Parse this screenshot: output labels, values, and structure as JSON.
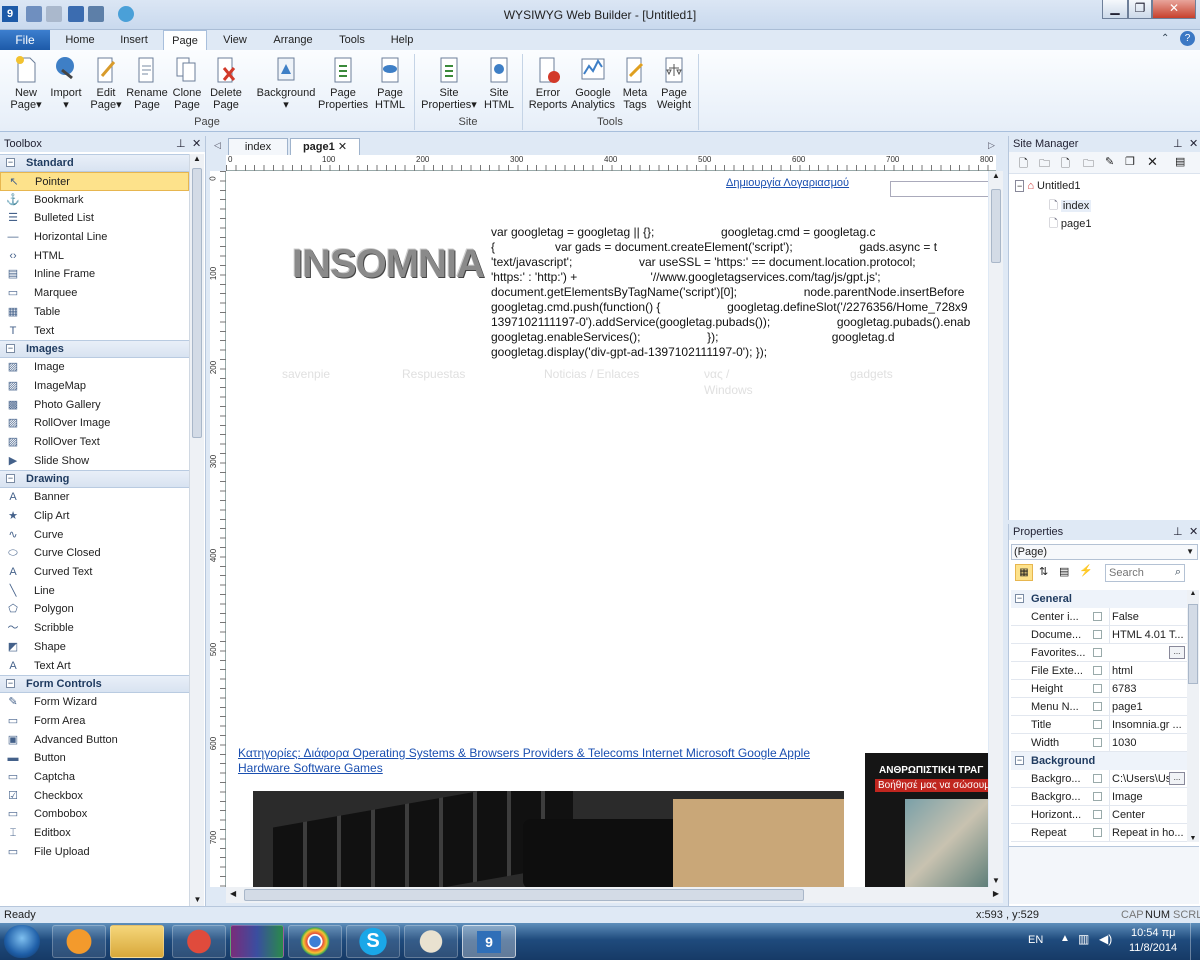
{
  "window": {
    "title": "WYSIWYG Web Builder - [Untitled1]",
    "app_badge": "9"
  },
  "ribbon_tabs": {
    "file": "File",
    "home": "Home",
    "insert": "Insert",
    "page": "Page",
    "view": "View",
    "arrange": "Arrange",
    "tools": "Tools",
    "help": "Help"
  },
  "ribbon": {
    "new_page_1": "New",
    "new_page_2": "Page",
    "import": "Import",
    "edit_page_1": "Edit",
    "edit_page_2": "Page",
    "rename_page_1": "Rename",
    "rename_page_2": "Page",
    "clone_page_1": "Clone",
    "clone_page_2": "Page",
    "delete_page_1": "Delete",
    "delete_page_2": "Page",
    "background": "Background",
    "page_properties_1": "Page",
    "page_properties_2": "Properties",
    "page_html_1": "Page",
    "page_html_2": "HTML",
    "site_properties_1": "Site",
    "site_properties_2": "Properties",
    "site_html_1": "Site",
    "site_html_2": "HTML",
    "error_reports_1": "Error",
    "error_reports_2": "Reports",
    "google_analytics_1": "Google",
    "google_analytics_2": "Analytics",
    "meta_tags_1": "Meta",
    "meta_tags_2": "Tags",
    "page_weight_1": "Page",
    "page_weight_2": "Weight",
    "group_page": "Page",
    "group_site": "Site",
    "group_tools": "Tools"
  },
  "toolbox": {
    "title": "Toolbox",
    "standard": {
      "label": "Standard",
      "items": [
        "Pointer",
        "Bookmark",
        "Bulleted List",
        "Horizontal Line",
        "HTML",
        "Inline Frame",
        "Marquee",
        "Table",
        "Text"
      ]
    },
    "images": {
      "label": "Images",
      "items": [
        "Image",
        "ImageMap",
        "Photo Gallery",
        "RollOver Image",
        "RollOver Text",
        "Slide Show"
      ]
    },
    "drawing": {
      "label": "Drawing",
      "items": [
        "Banner",
        "Clip Art",
        "Curve",
        "Curve Closed",
        "Curved Text",
        "Line",
        "Polygon",
        "Scribble",
        "Shape",
        "Text Art"
      ]
    },
    "form_controls": {
      "label": "Form Controls",
      "items": [
        "Form Wizard",
        "Form Area",
        "Advanced Button",
        "Button",
        "Captcha",
        "Checkbox",
        "Combobox",
        "Editbox",
        "File Upload"
      ]
    }
  },
  "doc_tabs": {
    "index": "index",
    "page1": "page1"
  },
  "ruler": {
    "h": [
      "0",
      "100",
      "200",
      "300",
      "400",
      "500",
      "600",
      "700",
      "800"
    ],
    "v": [
      "0",
      "100",
      "200",
      "300",
      "400",
      "500",
      "600",
      "700"
    ]
  },
  "canvas": {
    "account_link": "Δημιουργία Λογαριασμού",
    "logo_text": "INSOMNIA",
    "code_lines": [
      "var googletag = googletag || {};                    googletag.cmd = googletag.c",
      "{                  var gads = document.createElement('script');                    gads.async = t",
      "'text/javascript';                    var useSSL = 'https:' == document.location.protocol;",
      "'https:' : 'http:') +                      '//www.googletagservices.com/tag/js/gpt.js';",
      "document.getElementsByTagName('script')[0];                    node.parentNode.insertBefore",
      "googletag.cmd.push(function() {                    googletag.defineSlot('/2276356/Home_728x9",
      "1397102111197-0').addService(googletag.pubads());                    googletag.pubads().enab",
      "googletag.enableServices();                    });                                  googletag.d",
      "googletag.display('div-gpt-ad-1397102111197-0'); });"
    ],
    "faint_nav": [
      "savenpie",
      "Respuestas",
      "Noticias / Enlaces",
      "νας /",
      "Windows",
      "gadgets"
    ],
    "categories_line1": "Κατηγορίες: Διάφορα Operating Systems & Browsers Providers & Telecoms Internet Microsoft Google Apple",
    "categories_line2": "Hardware Software Games",
    "banner_line1": "ΑΝΘΡΩΠΙΣΤΙΚΗ ΤΡΑΓ",
    "banner_line2": "Βοήθησέ μας να σώσουμ"
  },
  "site_manager": {
    "title": "Site Manager",
    "root": "Untitled1",
    "pages": [
      "index",
      "page1"
    ]
  },
  "properties": {
    "title": "Properties",
    "selector": "(Page)",
    "search_placeholder": "Search",
    "general_label": "General",
    "general": [
      {
        "name": "Center i...",
        "value": "False"
      },
      {
        "name": "Docume...",
        "value": "HTML 4.01 T..."
      },
      {
        "name": "Favorites...",
        "value": ""
      },
      {
        "name": "File Exte...",
        "value": "html"
      },
      {
        "name": "Height",
        "value": "6783"
      },
      {
        "name": "Menu N...",
        "value": "page1"
      },
      {
        "name": "Title",
        "value": "Insomnia.gr ..."
      },
      {
        "name": "Width",
        "value": "1030"
      }
    ],
    "background_label": "Background",
    "background": [
      {
        "name": "Backgro...",
        "value": "C:\\Users\\Us"
      },
      {
        "name": "Backgro...",
        "value": "Image"
      },
      {
        "name": "Horizont...",
        "value": "Center"
      },
      {
        "name": "Repeat",
        "value": "Repeat in ho..."
      }
    ]
  },
  "status": {
    "left": "Ready",
    "coords": "x:593 , y:529",
    "cap": "CAP",
    "num": "NUM",
    "scrl": "SCRL"
  },
  "taskbar": {
    "lang": "EN",
    "time": "10:54 πμ",
    "date": "11/8/2014",
    "wb_badge": "9"
  },
  "colors": {
    "accent": "#1d5aa8",
    "selection": "#fde28b",
    "link": "#1a4fb0"
  }
}
